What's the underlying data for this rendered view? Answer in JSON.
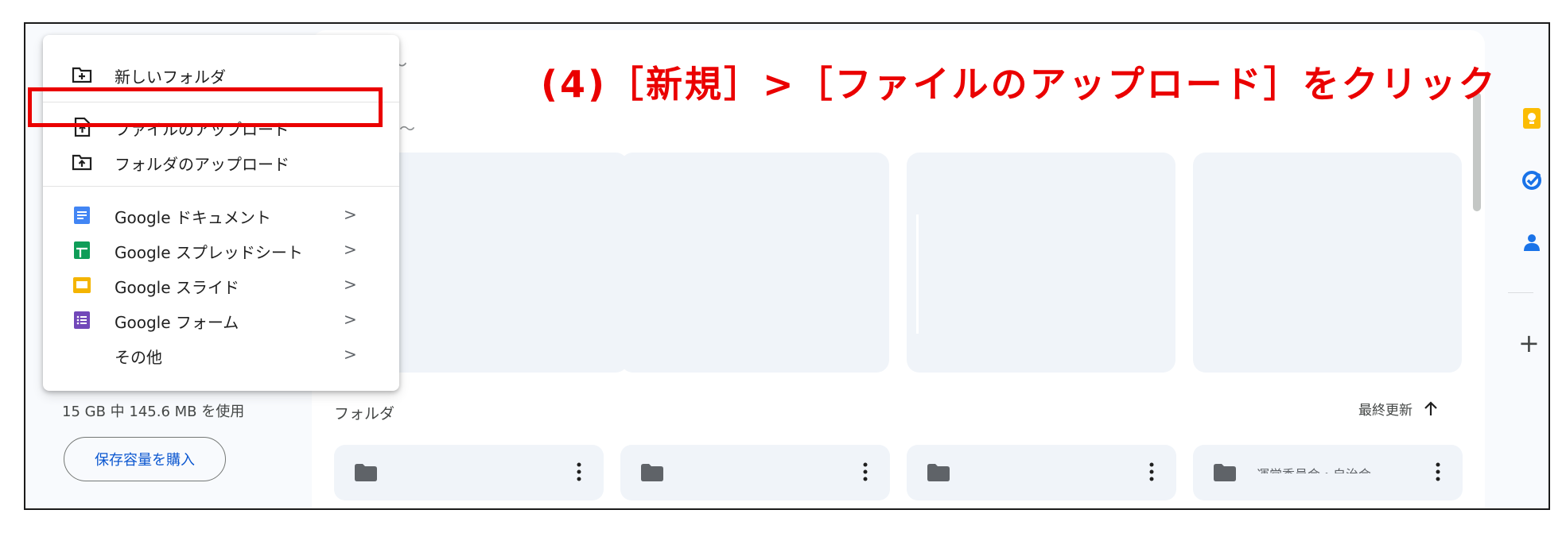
{
  "annotation": {
    "text": "(4)［新規］>［ファイルのアップロード］をクリック",
    "color": "#ea0000"
  },
  "new_menu": {
    "items": [
      {
        "label": "新しいフォルダ",
        "icon": "new-folder-icon"
      },
      {
        "label": "ファイルのアップロード",
        "icon": "file-upload-icon",
        "highlighted": true
      },
      {
        "label": "フォルダのアップロード",
        "icon": "folder-upload-icon"
      },
      {
        "label": "Google ドキュメント",
        "icon": "google-docs-icon",
        "color": "#4285f4",
        "chevron": ">"
      },
      {
        "label": "Google スプレッドシート",
        "icon": "google-sheets-icon",
        "color": "#0f9d58",
        "chevron": ">"
      },
      {
        "label": "Google スライド",
        "icon": "google-slides-icon",
        "color": "#f4b400",
        "chevron": ">"
      },
      {
        "label": "Google フォーム",
        "icon": "google-forms-icon",
        "color": "#7248b9",
        "chevron": ">"
      },
      {
        "label": "その他",
        "icon": "",
        "chevron": ">"
      }
    ]
  },
  "sidebar": {
    "storage_text": "15 GB 中 145.6 MB を使用",
    "buy_storage_label": "保存容量を購入"
  },
  "main": {
    "folders_heading": "フォルダ",
    "sort_label": "最終更新",
    "folders": [
      {
        "name": ""
      },
      {
        "name": ""
      },
      {
        "name": ""
      },
      {
        "name": "運営委員会・自治会"
      }
    ]
  },
  "right_rail": {
    "icons": [
      "keep-icon",
      "tasks-icon",
      "contacts-icon"
    ],
    "add_label": "+"
  },
  "colors": {
    "keep": "#fbbc04",
    "tasks": "#1a73e8",
    "contacts": "#1a73e8",
    "accent": "#0b57d0"
  }
}
